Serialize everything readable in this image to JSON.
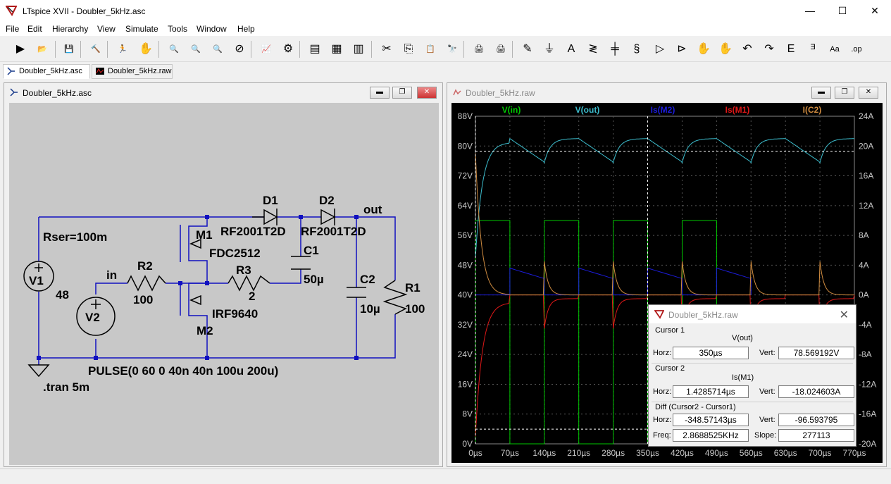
{
  "window": {
    "title": "LTspice XVII - Doubler_5kHz.asc",
    "minimize": "—",
    "maximize": "☐",
    "close": "✕"
  },
  "menu": [
    "File",
    "Edit",
    "Hierarchy",
    "View",
    "Simulate",
    "Tools",
    "Window",
    "Help"
  ],
  "toolbar_icons": [
    "run-icon",
    "open-icon",
    "save-icon",
    "control-panel-icon",
    "halt-icon",
    "pan-hand-icon",
    "zoom-in-icon",
    "zoom-fit-icon",
    "zoom-out-icon",
    "zoom-cancel-icon",
    "autorange-icon",
    "plot-settings-icon",
    "tile-horiz-icon",
    "cascade-icon",
    "tile-vert-icon",
    "cut-icon",
    "copy-icon",
    "paste-icon",
    "find-icon",
    "print-icon",
    "print-setup-icon",
    "draw-wire-icon",
    "ground-icon",
    "label-net-icon",
    "resistor-icon",
    "capacitor-icon",
    "inductor-icon",
    "diode-icon",
    "component-icon",
    "move-icon",
    "drag-icon",
    "undo-icon",
    "redo-icon",
    "rotate-icon",
    "mirror-icon",
    "text-icon",
    "spice-directive-icon"
  ],
  "tabs": [
    {
      "label": "Doubler_5kHz.asc",
      "active": true
    },
    {
      "label": "Doubler_5kHz.raw",
      "active": false
    }
  ],
  "schematic": {
    "title": "Doubler_5kHz.asc",
    "labels": {
      "d1": "D1",
      "d2": "D2",
      "out": "out",
      "d1_model": "RF2001T2D",
      "d2_model": "RF2001T2D",
      "rser": "Rser=100m",
      "m1": "M1",
      "m1_model": "FDC2512",
      "c1": "C1",
      "c1_val": "50µ",
      "r3": "R3",
      "r3_val": "2",
      "r2": "R2",
      "r2_val": "100",
      "in": "in",
      "v1": "V1",
      "v1_val": "48",
      "v2": "V2",
      "m2_model": "IRF9640",
      "m2": "M2",
      "c2": "C2",
      "c2_val": "10µ",
      "r1": "R1",
      "r1_val": "100",
      "pulse": "PULSE(0 60 0 40n 40n 100u 200u)",
      "tran": ".tran 5m"
    }
  },
  "waveform": {
    "title": "Doubler_5kHz.raw",
    "traces": [
      {
        "name": "V(in)",
        "color": "#00c800"
      },
      {
        "name": "V(out)",
        "color": "#3cbccc"
      },
      {
        "name": "Is(M2)",
        "color": "#1c1cdc"
      },
      {
        "name": "Is(M1)",
        "color": "#e01818"
      },
      {
        "name": "I(C2)",
        "color": "#d08c40"
      }
    ],
    "left_ticks": [
      "88V",
      "80V",
      "72V",
      "64V",
      "56V",
      "48V",
      "40V",
      "32V",
      "24V",
      "16V",
      "8V",
      "0V"
    ],
    "right_ticks": [
      "24A",
      "20A",
      "16A",
      "12A",
      "8A",
      "4A",
      "0A",
      "-4A",
      "-8A",
      "-12A",
      "-16A",
      "-20A"
    ],
    "x_ticks": [
      "0µs",
      "70µs",
      "140µs",
      "210µs",
      "280µs",
      "350µs",
      "420µs",
      "490µs",
      "560µs",
      "630µs",
      "700µs",
      "770µs"
    ]
  },
  "cursor_dialog": {
    "title": "Doubler_5kHz.raw",
    "cursor1_label": "Cursor 1",
    "cursor1_trace": "V(out)",
    "horz_label": "Horz:",
    "vert_label": "Vert:",
    "c1_horz": "350µs",
    "c1_vert": "78.569192V",
    "cursor2_label": "Cursor 2",
    "cursor2_trace": "Is(M1)",
    "c2_horz": "1.4285714µs",
    "c2_vert": "-18.024603A",
    "diff_label": "Diff (Cursor2 - Cursor1)",
    "diff_horz": "-348.57143µs",
    "diff_vert": "-96.593795",
    "freq_label": "Freq:",
    "freq": "2.8688525KHz",
    "slope_label": "Slope:",
    "slope": "277113"
  },
  "colors": {
    "plot_bg": "#000000",
    "schematic_bg": "#c8c8c8",
    "wire": "#1010c0"
  }
}
